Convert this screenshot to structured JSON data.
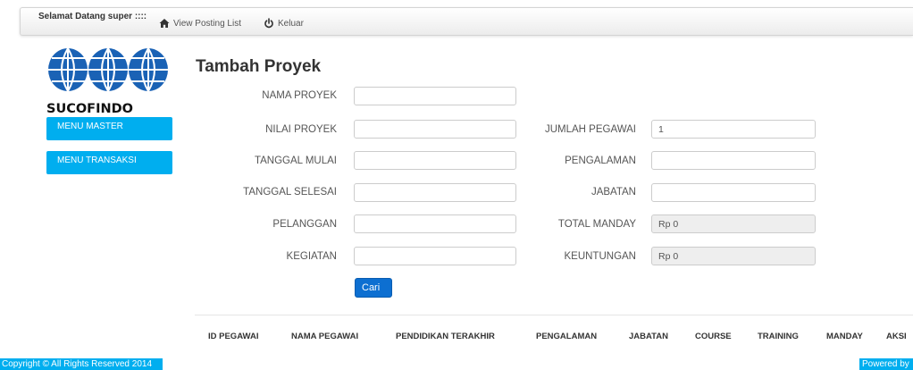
{
  "navbar": {
    "welcome": "Selamat Datang super ::::",
    "links": [
      {
        "label": "View Posting List",
        "icon": "home-icon"
      },
      {
        "label": "Keluar",
        "icon": "power-icon"
      }
    ]
  },
  "brand": {
    "logo_text": "SUCOFINDO",
    "accent_color": "#00aeef",
    "logo_color": "#1a62b5"
  },
  "sidebar": {
    "items": [
      {
        "label": "MENU MASTER"
      },
      {
        "label": "MENU TRANSAKSI"
      }
    ]
  },
  "main": {
    "title": "Tambah Proyek",
    "form_left": [
      {
        "label": "NAMA PROYEK",
        "value": ""
      },
      {
        "label": "NILAI PROYEK",
        "value": ""
      },
      {
        "label": "TANGGAL MULAI",
        "value": ""
      },
      {
        "label": "TANGGAL SELESAI",
        "value": ""
      },
      {
        "label": "PELANGGAN",
        "value": ""
      },
      {
        "label": "KEGIATAN",
        "value": ""
      }
    ],
    "form_right": [
      {
        "label": "JUMLAH PEGAWAI",
        "value": "1"
      },
      {
        "label": "PENGALAMAN",
        "value": ""
      },
      {
        "label": "JABATAN",
        "value": ""
      },
      {
        "label": "TOTAL MANDAY",
        "value": "Rp 0"
      },
      {
        "label": "KEUNTUNGAN",
        "value": "Rp 0"
      }
    ],
    "search_button": "Cari",
    "table_headers": [
      "ID PEGAWAI",
      "NAMA PEGAWAI",
      "PENDIDIKAN TERAKHIR",
      "PENGALAMAN",
      "JABATAN",
      "COURSE",
      "TRAINING",
      "MANDAY",
      "AKSI"
    ]
  },
  "footer": {
    "left": "Copyright © All Rights Reserved 2014",
    "right": "Powered by"
  }
}
